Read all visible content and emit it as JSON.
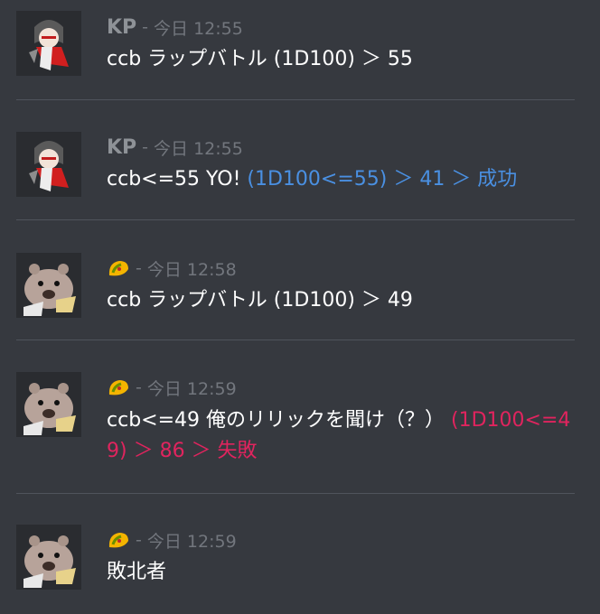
{
  "messages": [
    {
      "username": "KP",
      "separator": "-",
      "timestamp": "今日 12:55",
      "text": "ccb ラップバトル (1D100) ＞ 55",
      "roll": ""
    },
    {
      "username": "KP",
      "separator": "-",
      "timestamp": "今日 12:55",
      "text": "ccb<=55 YO! ",
      "roll": "(1D100<=55) ＞ 41 ＞ 成功"
    },
    {
      "username": "",
      "separator": "-",
      "timestamp": "今日 12:58",
      "text": "ccb ラップバトル (1D100) ＞ 49",
      "roll": ""
    },
    {
      "username": "",
      "separator": "-",
      "timestamp": "今日 12:59",
      "text": "ccb<=49 俺のリリックを聞け（？） ",
      "roll": "(1D100<=49) ＞ 86 ＞ 失敗"
    },
    {
      "username": "",
      "separator": "-",
      "timestamp": "今日 12:59",
      "text": "敗北者",
      "roll": ""
    }
  ],
  "avatars": {
    "kp": "hooded-character-avatar",
    "wombat": "wombat-avatar"
  },
  "colors": {
    "background": "#36393f",
    "success": "#4a90e2",
    "failure": "#e0245e"
  }
}
